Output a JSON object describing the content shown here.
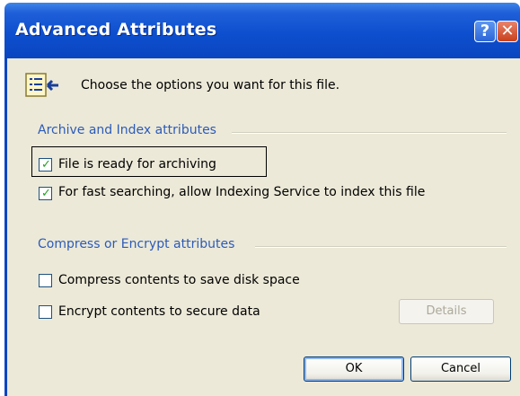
{
  "window": {
    "title": "Advanced Attributes"
  },
  "title_buttons": {
    "help": "?",
    "close": "✕"
  },
  "header": {
    "text": "Choose the options you want for this file.",
    "icon": "attributes-list-icon"
  },
  "archive_group": {
    "label": "Archive and Index attributes",
    "items": [
      {
        "label": "File is ready for archiving",
        "checked": true
      },
      {
        "label": "For fast searching, allow Indexing Service to index this file",
        "checked": true
      }
    ]
  },
  "compress_group": {
    "label": "Compress or Encrypt attributes",
    "items": [
      {
        "label": "Compress contents to save disk space",
        "checked": false
      },
      {
        "label": "Encrypt contents to secure data",
        "checked": false
      }
    ]
  },
  "buttons": {
    "details": "Details",
    "ok": "OK",
    "cancel": "Cancel"
  },
  "colors": {
    "titlebar": "#0a45c0",
    "dialog_bg": "#ece9d8",
    "group_label": "#2c5bb8",
    "check_mark": "#21a121"
  }
}
